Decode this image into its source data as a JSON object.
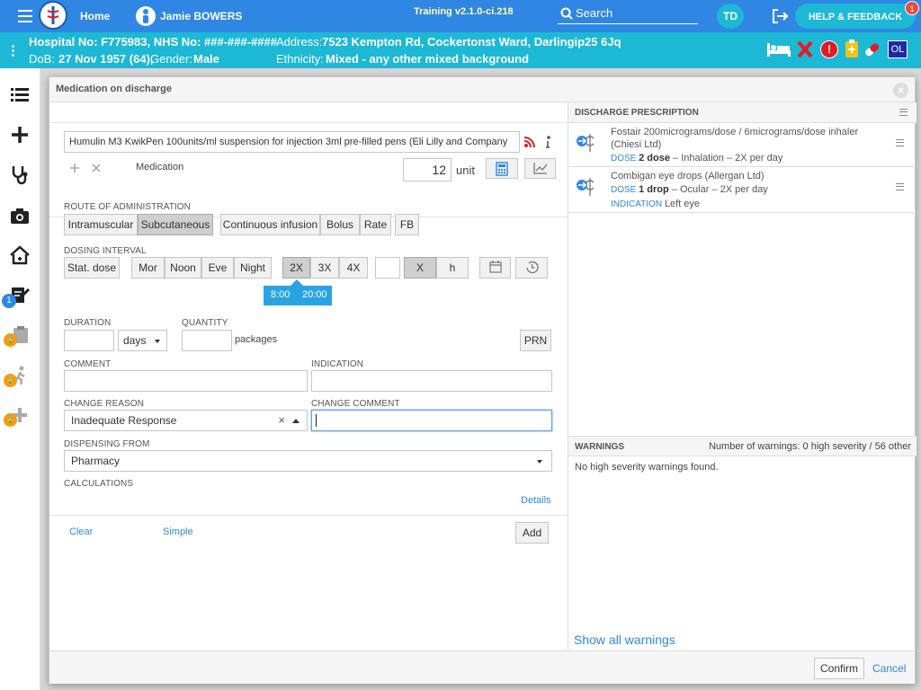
{
  "topbar": {
    "home_label": "Home",
    "patient_name": "Jamie BOWERS",
    "version": "Training v2.1.0-ci.218",
    "search_label": "Search",
    "user_initials": "TD",
    "help_label": "HELP & FEEDBACK",
    "help_badge": "1"
  },
  "patient": {
    "line1_left": "Hospital No: F775983, NHS No: ###-###-####",
    "address_label": "Address:",
    "address_value": "7523 Kempton Rd, Cockertonst Ward, Darlingip25 6Jq",
    "dob_label": "DoB:",
    "dob_value": "27 Nov 1957 (64),",
    "gender_label": "Gender:",
    "gender_value": "Male",
    "ethnicity_label": "Ethnicity:",
    "ethnicity_value": "Mixed - any other mixed background",
    "ol_badge": "OL"
  },
  "sidebar": {
    "badge_count": "1",
    "lock_glyph": "🔒"
  },
  "modal": {
    "title": "Medication on discharge",
    "medication_text": "Humulin M3 KwikPen 100units/ml suspension for injection 3ml pre-filled pens (Eli Lilly and Company",
    "medication_label": "Medication",
    "dose_value": "12",
    "dose_unit": "unit",
    "route_label": "ROUTE OF ADMINISTRATION",
    "routes": [
      "Intramuscular",
      "Subcutaneous",
      "Continuous infusion",
      "Bolus",
      "Rate",
      "FB"
    ],
    "dosing_label": "DOSING INTERVAL",
    "stat_dose": "Stat. dose",
    "times": [
      "Mor",
      "Noon",
      "Eve",
      "Night"
    ],
    "freq": [
      "2X",
      "3X",
      "4X"
    ],
    "x_label": "X",
    "h_label": "h",
    "time_chips": [
      "8:00",
      "20:00"
    ],
    "duration_label": "DURATION",
    "duration_unit": "days",
    "quantity_label": "QUANTITY",
    "quantity_unit": "packages",
    "prn": "PRN",
    "comment_label": "COMMENT",
    "indication_label": "INDICATION",
    "change_reason_label": "CHANGE REASON",
    "change_reason_value": "Inadequate Response",
    "change_comment_label": "CHANGE COMMENT",
    "dispensing_label": "DISPENSING FROM",
    "dispensing_value": "Pharmacy",
    "calculations_label": "CALCULATIONS",
    "details_link": "Details",
    "clear_link": "Clear",
    "simple_link": "Simple",
    "add_button": "Add",
    "confirm_button": "Confirm",
    "cancel_link": "Cancel"
  },
  "prescription": {
    "header": "DISCHARGE PRESCRIPTION",
    "items": [
      {
        "title": "Fostair 200micrograms/dose / 6micrograms/dose inhaler (Chiesi Ltd)",
        "dose_label": "DOSE",
        "dose_value": "2 dose",
        "dose_rest": " – Inhalation – 2X per day"
      },
      {
        "title": "Combigan eye drops (Allergan Ltd)",
        "dose_label": "DOSE",
        "dose_value": "1 drop",
        "dose_rest": " – Ocular – 2X per day",
        "indication_label": "INDICATION",
        "indication_value": "Left eye"
      }
    ]
  },
  "warnings": {
    "header": "WARNINGS",
    "count_text": "Number of warnings: 0 high severity / 56 other",
    "body": "No high severity warnings found.",
    "show_all": "Show all warnings"
  },
  "colors": {
    "topbar": "#2f87e3",
    "patient_bar": "#1cb8d6",
    "accent": "#2f87e3",
    "red": "#e31b23"
  }
}
